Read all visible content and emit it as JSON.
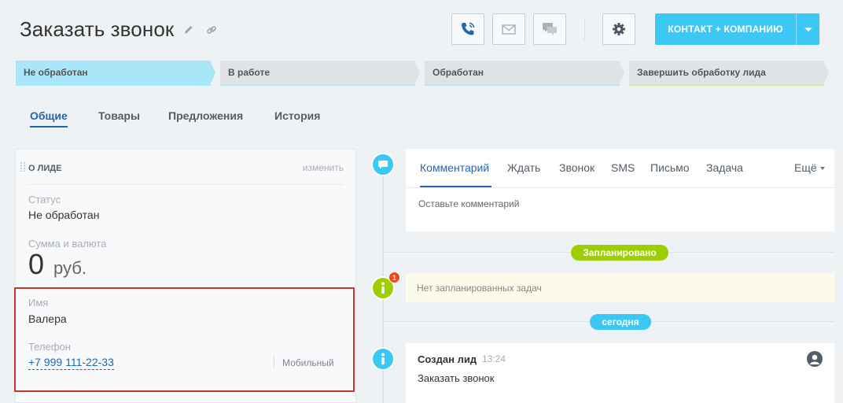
{
  "header": {
    "title": "Заказать звонок",
    "contact_button": "КОНТАКТ + КОМПАНИЮ"
  },
  "stages": [
    {
      "label": "Не обработан",
      "color": "#a8e6f8"
    },
    {
      "label": "В работе",
      "color": "#dfe3e6"
    },
    {
      "label": "Обработан",
      "color": "#dfe3e6"
    },
    {
      "label": "Завершить обработку лида",
      "color": "#dfe3e6"
    }
  ],
  "tabs": [
    "Общие",
    "Товары",
    "Предложения",
    "История"
  ],
  "lead": {
    "heading": "О ЛИДЕ",
    "edit": "изменить",
    "status_label": "Статус",
    "status_value": "Не обработан",
    "sum_label": "Сумма и валюта",
    "sum_value": "0",
    "currency": "руб.",
    "name_label": "Имя",
    "name_value": "Валера",
    "phone_label": "Телефон",
    "phone_value": "+7 999 111-22-33",
    "phone_type": "Мобильный"
  },
  "activity": {
    "tabs": [
      "Комментарий",
      "Ждать",
      "Звонок",
      "SMS",
      "Письмо",
      "Задача"
    ],
    "more": "Ещё",
    "placeholder": "Оставьте комментарий"
  },
  "timeline": {
    "planned_pill": "Запланировано",
    "planned_badge": "1",
    "no_tasks": "Нет запланированных задач",
    "today_pill": "сегодня",
    "created_title": "Создан лид",
    "created_time": "13:24",
    "created_text": "Заказать звонок"
  },
  "colors": {
    "accent": "#3bc8f5",
    "link": "#2067b0",
    "planned": "#9dcf00",
    "badge": "#f54819",
    "highlight": "#c0392b"
  }
}
